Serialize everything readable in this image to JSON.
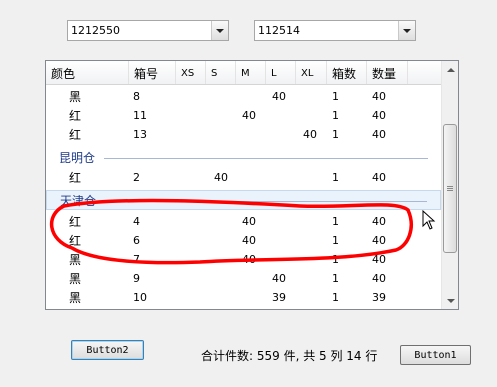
{
  "filters": {
    "left_value": "1212550",
    "right_value": "112514"
  },
  "grid": {
    "columns": [
      "颜色",
      "箱号",
      "XS",
      "S",
      "M",
      "L",
      "XL",
      "箱数",
      "数量"
    ],
    "rows_top": [
      {
        "color": "黑",
        "box": "8",
        "XS": "",
        "S": "",
        "M": "",
        "L": "40",
        "XL": "",
        "boxes": "1",
        "qty": "40"
      },
      {
        "color": "红",
        "box": "11",
        "XS": "",
        "S": "",
        "M": "40",
        "L": "",
        "XL": "",
        "boxes": "1",
        "qty": "40"
      },
      {
        "color": "红",
        "box": "13",
        "XS": "",
        "S": "",
        "M": "",
        "L": "",
        "XL": "40",
        "boxes": "1",
        "qty": "40"
      }
    ],
    "group_kunming": "昆明仓",
    "rows_kunming": [
      {
        "color": "红",
        "box": "2",
        "XS": "",
        "S": "40",
        "M": "",
        "L": "",
        "XL": "",
        "boxes": "1",
        "qty": "40"
      }
    ],
    "group_tianjin": "天津仓",
    "rows_tianjin": [
      {
        "color": "红",
        "box": "4",
        "XS": "",
        "S": "",
        "M": "40",
        "L": "",
        "XL": "",
        "boxes": "1",
        "qty": "40"
      },
      {
        "color": "红",
        "box": "6",
        "XS": "",
        "S": "",
        "M": "40",
        "L": "",
        "XL": "",
        "boxes": "1",
        "qty": "40"
      },
      {
        "color": "黑",
        "box": "7",
        "XS": "",
        "S": "",
        "M": "40",
        "L": "",
        "XL": "",
        "boxes": "1",
        "qty": "40"
      },
      {
        "color": "黑",
        "box": "9",
        "XS": "",
        "S": "",
        "M": "",
        "L": "40",
        "XL": "",
        "boxes": "1",
        "qty": "40"
      },
      {
        "color": "黑",
        "box": "10",
        "XS": "",
        "S": "",
        "M": "",
        "L": "39",
        "XL": "",
        "boxes": "1",
        "qty": "39"
      }
    ]
  },
  "footer": {
    "button2_label": "Button2",
    "button1_label": "Button1",
    "status_text": "合计件数: 559 件, 共 5 列 14 行"
  },
  "annotation": {
    "stroke_color": "#ff0000"
  }
}
